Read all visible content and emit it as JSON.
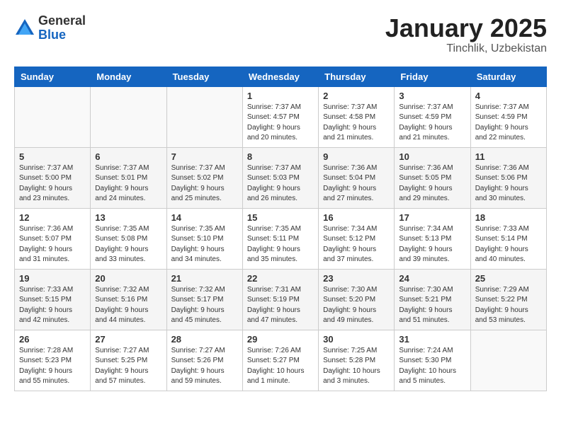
{
  "logo": {
    "general": "General",
    "blue": "Blue"
  },
  "title": "January 2025",
  "subtitle": "Tinchlik, Uzbekistan",
  "days_of_week": [
    "Sunday",
    "Monday",
    "Tuesday",
    "Wednesday",
    "Thursday",
    "Friday",
    "Saturday"
  ],
  "weeks": [
    [
      {
        "day": "",
        "content": ""
      },
      {
        "day": "",
        "content": ""
      },
      {
        "day": "",
        "content": ""
      },
      {
        "day": "1",
        "content": "Sunrise: 7:37 AM\nSunset: 4:57 PM\nDaylight: 9 hours\nand 20 minutes."
      },
      {
        "day": "2",
        "content": "Sunrise: 7:37 AM\nSunset: 4:58 PM\nDaylight: 9 hours\nand 21 minutes."
      },
      {
        "day": "3",
        "content": "Sunrise: 7:37 AM\nSunset: 4:59 PM\nDaylight: 9 hours\nand 21 minutes."
      },
      {
        "day": "4",
        "content": "Sunrise: 7:37 AM\nSunset: 4:59 PM\nDaylight: 9 hours\nand 22 minutes."
      }
    ],
    [
      {
        "day": "5",
        "content": "Sunrise: 7:37 AM\nSunset: 5:00 PM\nDaylight: 9 hours\nand 23 minutes."
      },
      {
        "day": "6",
        "content": "Sunrise: 7:37 AM\nSunset: 5:01 PM\nDaylight: 9 hours\nand 24 minutes."
      },
      {
        "day": "7",
        "content": "Sunrise: 7:37 AM\nSunset: 5:02 PM\nDaylight: 9 hours\nand 25 minutes."
      },
      {
        "day": "8",
        "content": "Sunrise: 7:37 AM\nSunset: 5:03 PM\nDaylight: 9 hours\nand 26 minutes."
      },
      {
        "day": "9",
        "content": "Sunrise: 7:36 AM\nSunset: 5:04 PM\nDaylight: 9 hours\nand 27 minutes."
      },
      {
        "day": "10",
        "content": "Sunrise: 7:36 AM\nSunset: 5:05 PM\nDaylight: 9 hours\nand 29 minutes."
      },
      {
        "day": "11",
        "content": "Sunrise: 7:36 AM\nSunset: 5:06 PM\nDaylight: 9 hours\nand 30 minutes."
      }
    ],
    [
      {
        "day": "12",
        "content": "Sunrise: 7:36 AM\nSunset: 5:07 PM\nDaylight: 9 hours\nand 31 minutes."
      },
      {
        "day": "13",
        "content": "Sunrise: 7:35 AM\nSunset: 5:08 PM\nDaylight: 9 hours\nand 33 minutes."
      },
      {
        "day": "14",
        "content": "Sunrise: 7:35 AM\nSunset: 5:10 PM\nDaylight: 9 hours\nand 34 minutes."
      },
      {
        "day": "15",
        "content": "Sunrise: 7:35 AM\nSunset: 5:11 PM\nDaylight: 9 hours\nand 35 minutes."
      },
      {
        "day": "16",
        "content": "Sunrise: 7:34 AM\nSunset: 5:12 PM\nDaylight: 9 hours\nand 37 minutes."
      },
      {
        "day": "17",
        "content": "Sunrise: 7:34 AM\nSunset: 5:13 PM\nDaylight: 9 hours\nand 39 minutes."
      },
      {
        "day": "18",
        "content": "Sunrise: 7:33 AM\nSunset: 5:14 PM\nDaylight: 9 hours\nand 40 minutes."
      }
    ],
    [
      {
        "day": "19",
        "content": "Sunrise: 7:33 AM\nSunset: 5:15 PM\nDaylight: 9 hours\nand 42 minutes."
      },
      {
        "day": "20",
        "content": "Sunrise: 7:32 AM\nSunset: 5:16 PM\nDaylight: 9 hours\nand 44 minutes."
      },
      {
        "day": "21",
        "content": "Sunrise: 7:32 AM\nSunset: 5:17 PM\nDaylight: 9 hours\nand 45 minutes."
      },
      {
        "day": "22",
        "content": "Sunrise: 7:31 AM\nSunset: 5:19 PM\nDaylight: 9 hours\nand 47 minutes."
      },
      {
        "day": "23",
        "content": "Sunrise: 7:30 AM\nSunset: 5:20 PM\nDaylight: 9 hours\nand 49 minutes."
      },
      {
        "day": "24",
        "content": "Sunrise: 7:30 AM\nSunset: 5:21 PM\nDaylight: 9 hours\nand 51 minutes."
      },
      {
        "day": "25",
        "content": "Sunrise: 7:29 AM\nSunset: 5:22 PM\nDaylight: 9 hours\nand 53 minutes."
      }
    ],
    [
      {
        "day": "26",
        "content": "Sunrise: 7:28 AM\nSunset: 5:23 PM\nDaylight: 9 hours\nand 55 minutes."
      },
      {
        "day": "27",
        "content": "Sunrise: 7:27 AM\nSunset: 5:25 PM\nDaylight: 9 hours\nand 57 minutes."
      },
      {
        "day": "28",
        "content": "Sunrise: 7:27 AM\nSunset: 5:26 PM\nDaylight: 9 hours\nand 59 minutes."
      },
      {
        "day": "29",
        "content": "Sunrise: 7:26 AM\nSunset: 5:27 PM\nDaylight: 10 hours\nand 1 minute."
      },
      {
        "day": "30",
        "content": "Sunrise: 7:25 AM\nSunset: 5:28 PM\nDaylight: 10 hours\nand 3 minutes."
      },
      {
        "day": "31",
        "content": "Sunrise: 7:24 AM\nSunset: 5:30 PM\nDaylight: 10 hours\nand 5 minutes."
      },
      {
        "day": "",
        "content": ""
      }
    ]
  ]
}
